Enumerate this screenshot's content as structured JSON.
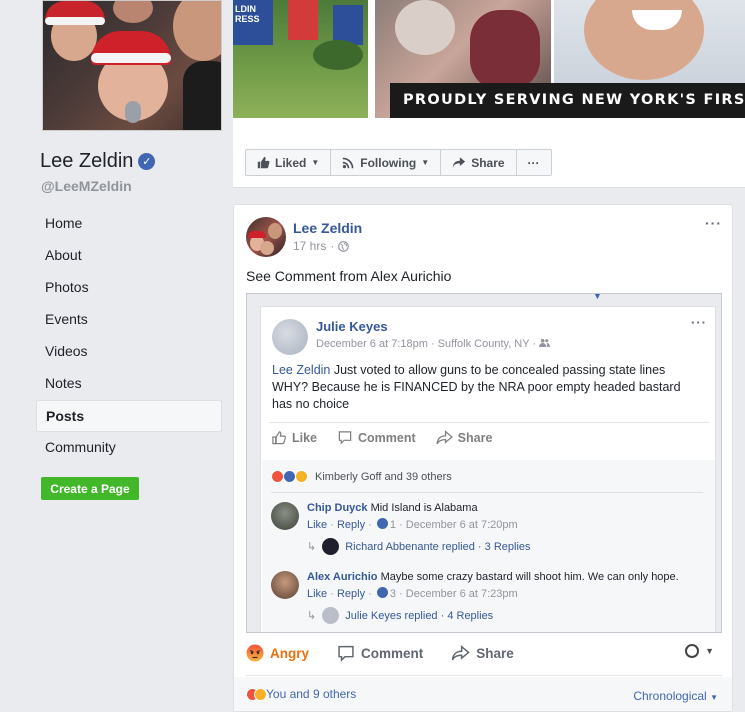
{
  "page": {
    "name": "Lee Zeldin",
    "handle": "@LeeMZeldin",
    "verified_icon": "verified-badge-icon"
  },
  "nav": {
    "items": [
      {
        "label": "Home"
      },
      {
        "label": "About"
      },
      {
        "label": "Photos"
      },
      {
        "label": "Events"
      },
      {
        "label": "Videos"
      },
      {
        "label": "Notes"
      },
      {
        "label": "Posts",
        "active": true
      },
      {
        "label": "Community"
      }
    ],
    "create_page": "Create a Page"
  },
  "cover": {
    "banner": "PROUDLY SERVING NEW YORK'S FIRST CONGRESSIONAL DISTRICT",
    "sign_text": "LDIN",
    "sign_text2": "RESS"
  },
  "actions": {
    "liked": "Liked",
    "following": "Following",
    "share": "Share",
    "more": "···"
  },
  "post": {
    "author": "Lee Zeldin",
    "time": "17 hrs",
    "menu": "···",
    "text": "See Comment from Alex Aurichio",
    "embedded": {
      "author": "Julie Keyes",
      "meta": "December 6 at 7:18pm · Suffolk County, NY · ",
      "menu": "···",
      "mention": "Lee Zeldin",
      "body": " Just voted to allow guns to be concealed passing state lines WHY? Because he is FINANCED by the NRA poor empty headed bastard has no choice",
      "actions": {
        "like": "Like",
        "comment": "Comment",
        "share": "Share"
      },
      "reactions_text": "Kimberly Goff and 39 others",
      "comments": [
        {
          "name": "Chip Duyck",
          "text": "Mid Island is Alabama",
          "like": "Like",
          "reply": "Reply",
          "count": "1",
          "time": "December 6 at 7:20pm",
          "replied": "Richard Abbenante replied · 3 Replies"
        },
        {
          "name": "Alex Aurichio",
          "text": "Maybe some crazy bastard will shoot him. We can only hope.",
          "like": "Like",
          "reply": "Reply",
          "count": "3",
          "time": "December 6 at 7:23pm",
          "replied": "Julie Keyes replied · 4 Replies"
        }
      ]
    },
    "actions": {
      "angry": "Angry",
      "comment": "Comment",
      "share": "Share"
    },
    "footer": {
      "reactions": "You and 9 others",
      "sort": "Chronological"
    }
  },
  "colors": {
    "brand": "#4267b2",
    "link": "#365899",
    "angry": "#e9710f",
    "create_green": "#42b72a"
  }
}
